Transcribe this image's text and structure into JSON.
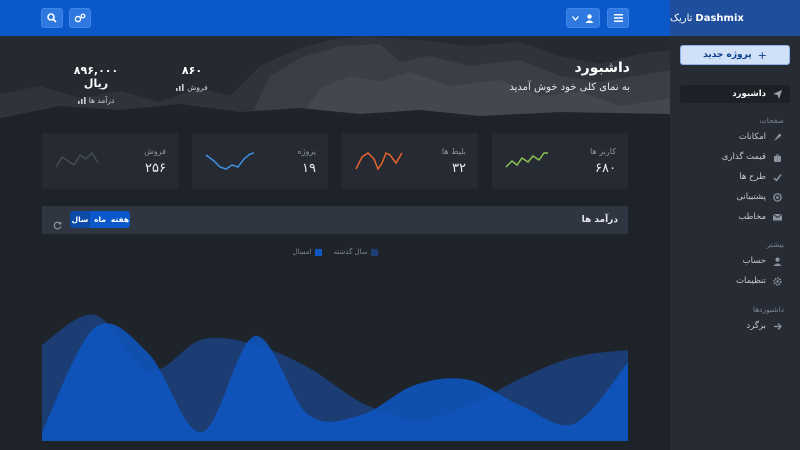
{
  "brand": {
    "name": "Dashmix",
    "suffix": "تاریک"
  },
  "header": {
    "user_icon": "user-icon",
    "menu_icon": "menu-icon",
    "search_icon": "search-icon",
    "settings_icon": "cogs-icon"
  },
  "sidebar": {
    "new_project_label": "پروژه جدید",
    "dashboard_label": "داشبورد",
    "section_pages": "صفحات",
    "pages": [
      {
        "label": "امکانات",
        "icon": "rocket-icon"
      },
      {
        "label": "قیمت گذاری",
        "icon": "bag-icon"
      },
      {
        "label": "طرح ها",
        "icon": "check-icon"
      },
      {
        "label": "پشتیبانی",
        "icon": "support-icon"
      },
      {
        "label": "مخاطب",
        "icon": "envelope-icon"
      }
    ],
    "section_more": "بیشتر",
    "more": [
      {
        "label": "حساب",
        "icon": "user-icon"
      },
      {
        "label": "تنظیمات",
        "icon": "cog-icon"
      }
    ],
    "section_dashboards": "داشبوردها",
    "dashboards": [
      {
        "label": "برگرد",
        "icon": "arrow-back-icon"
      }
    ]
  },
  "hero": {
    "title": "داشبورد",
    "subtitle": "به نمای کلی خود خوش آمدید",
    "stats": [
      {
        "value": "۸۹۶,۰۰۰ ریال",
        "label": "درآمد ها"
      },
      {
        "value": "۸۶۰",
        "label": "فروش"
      }
    ]
  },
  "cards": [
    {
      "label": "کاربر ها",
      "value": "۶۸۰",
      "color": "#8cc152"
    },
    {
      "label": "بلیط ها",
      "value": "۳۲",
      "color": "#e8642c"
    },
    {
      "label": "پروژه",
      "value": "۱۹",
      "color": "#3d8fe0"
    },
    {
      "label": "فروش",
      "value": "۲۵۶",
      "color": "#454b55"
    }
  ],
  "chart_panel": {
    "title": "درآمد ها",
    "tabs": [
      "سال",
      "ماه",
      "هفته"
    ],
    "active_tab": "سال"
  },
  "chart_data": {
    "type": "area",
    "series": [
      {
        "name": "سال گذشته",
        "color": "#1b3d74",
        "values": [
          0.55,
          0.72,
          0.4,
          0.58,
          0.55,
          0.42,
          0.22,
          0.12,
          0.2,
          0.36,
          0.48,
          0.52
        ]
      },
      {
        "name": "امسال",
        "color": "#0d57c4",
        "values": [
          0.05,
          0.65,
          0.5,
          0.05,
          0.6,
          0.15,
          0.15,
          0.32,
          0.35,
          0.2,
          0.1,
          0.45
        ]
      }
    ]
  }
}
